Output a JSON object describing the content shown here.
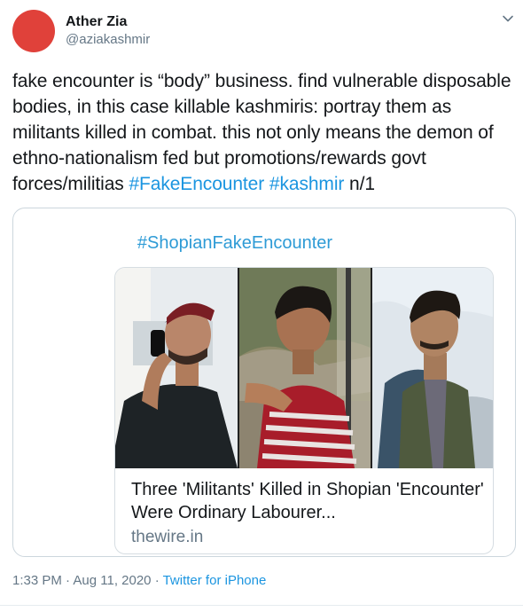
{
  "author": {
    "name": "Ather Zia",
    "handle": "@aziakashmir",
    "avatar_color": "#e0413a"
  },
  "tweet": {
    "text_part1": "fake encounter is “body” business. find vulnerable disposable bodies, in this case killable kashmiris: portray them as militants killed in combat. this not only means the demon of ethno-nationalism fed but promotions/rewards govt forces/militias ",
    "hashtag1": "#FakeEncounter",
    "space": " ",
    "hashtag2": "#kashmir",
    "text_part2": " n/1",
    "link_color": "#1b95e0"
  },
  "card": {
    "hashtag_title": "#ShopianFakeEncounter",
    "title": "Three 'Militants' Killed in Shopian 'Encounter' Were Ordinary Labourer...",
    "domain": "thewire.in"
  },
  "footer": {
    "time": "1:33 PM",
    "separator": " · ",
    "date": "Aug 11, 2020",
    "separator2": " · ",
    "source": "Twitter for iPhone"
  },
  "icons": {
    "menu": "chevron-down-icon"
  }
}
